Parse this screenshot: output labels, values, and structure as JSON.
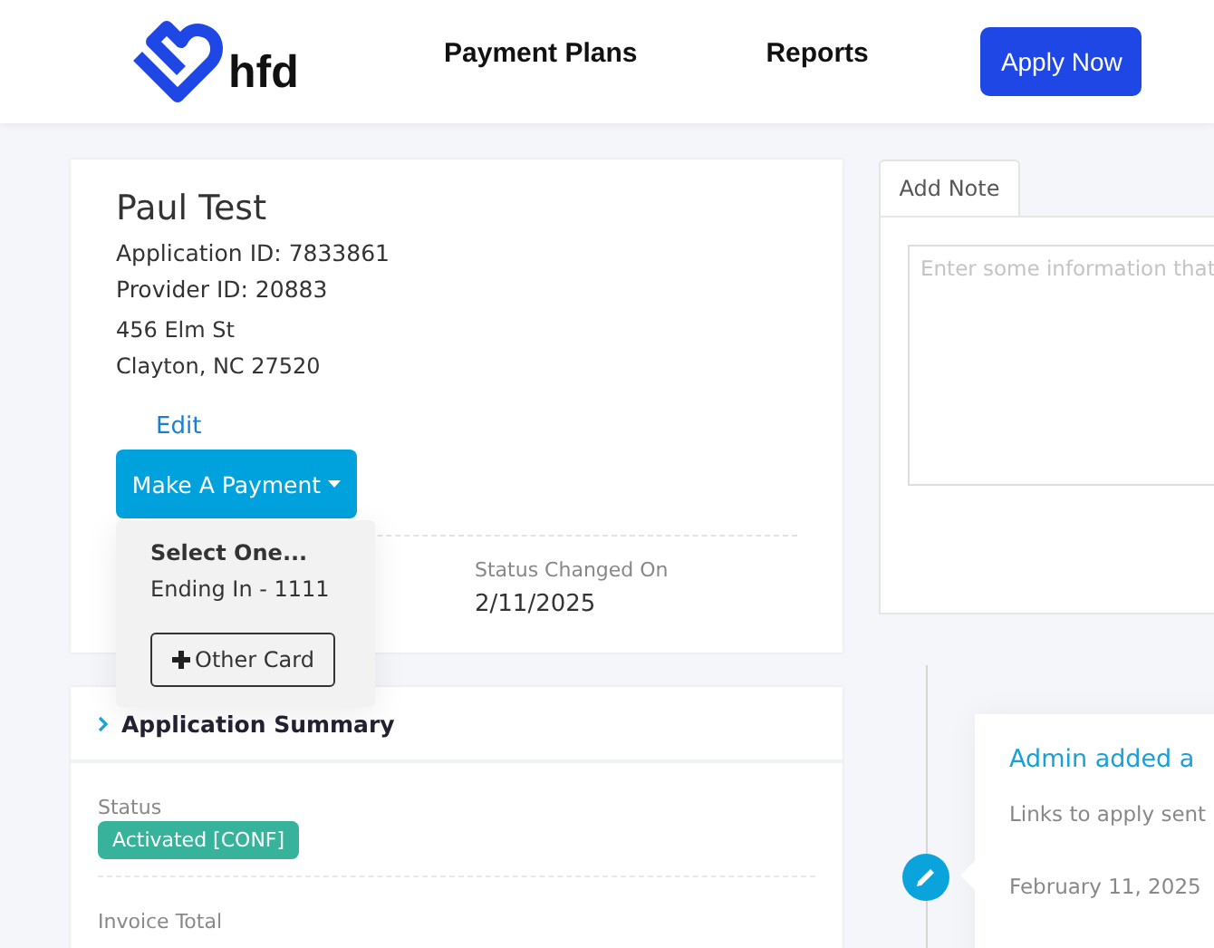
{
  "header": {
    "logo_text": "hfd",
    "nav": [
      {
        "label": "Payment Plans"
      },
      {
        "label": "Reports"
      }
    ],
    "apply_button": "Apply Now"
  },
  "customer": {
    "name": "Paul Test",
    "application_id": "Application ID: 7833861",
    "provider_id": "Provider ID: 20883",
    "address_line_1": "456 Elm St",
    "address_line_2": "Clayton, NC 27520",
    "edit_link": "Edit",
    "payment_button": "Make A Payment",
    "status_changed_label": "Status Changed On",
    "status_changed_value": "2/11/2025"
  },
  "payment_menu": {
    "expanded": true,
    "heading": "Select One...",
    "items": [
      "Ending In - 1111"
    ],
    "other_card_button": "Other Card"
  },
  "summary": {
    "title": "Application Summary",
    "expanded": false,
    "status_label": "Status",
    "status_badge": "Activated [CONF]",
    "invoice_label": "Invoice Total"
  },
  "notes": {
    "tabs": [
      {
        "label": "Add Note",
        "selected": true
      }
    ],
    "placeholder": "Enter some information that"
  },
  "timeline": [
    {
      "title": "Admin added a",
      "text": "Links to apply sent",
      "date": "February 11, 2025"
    }
  ]
}
